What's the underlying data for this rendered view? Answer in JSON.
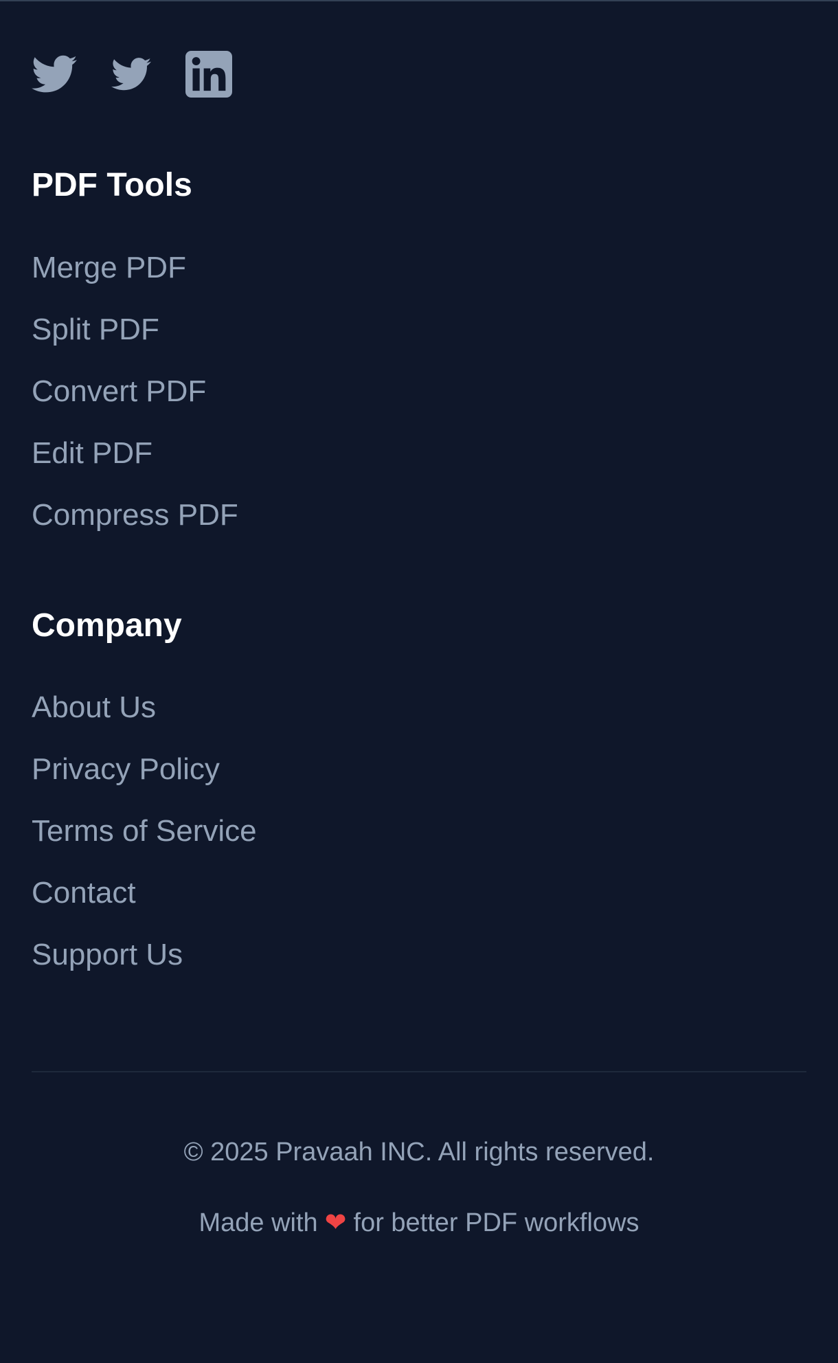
{
  "social": {
    "items": [
      {
        "icon": "twitter-icon",
        "label": "Twitter"
      },
      {
        "icon": "twitter-icon",
        "label": "Twitter"
      },
      {
        "icon": "linkedin-icon",
        "label": "LinkedIn"
      }
    ]
  },
  "pdf_tools": {
    "title": "PDF Tools",
    "links": [
      "Merge PDF",
      "Split PDF",
      "Convert PDF",
      "Edit PDF",
      "Compress PDF"
    ]
  },
  "company": {
    "title": "Company",
    "links": [
      "About Us",
      "Privacy Policy",
      "Terms of Service",
      "Contact",
      "Support Us"
    ]
  },
  "bottom": {
    "copyright": "© 2025 Pravaah INC. All rights reserved.",
    "made_with_prefix": "Made with",
    "heart": "❤",
    "made_with_suffix": "for better PDF workflows"
  },
  "colors": {
    "background": "#0f172a",
    "heading": "#ffffff",
    "link": "#94a3b8",
    "divider": "#1e293b",
    "heart": "#ef4444"
  }
}
